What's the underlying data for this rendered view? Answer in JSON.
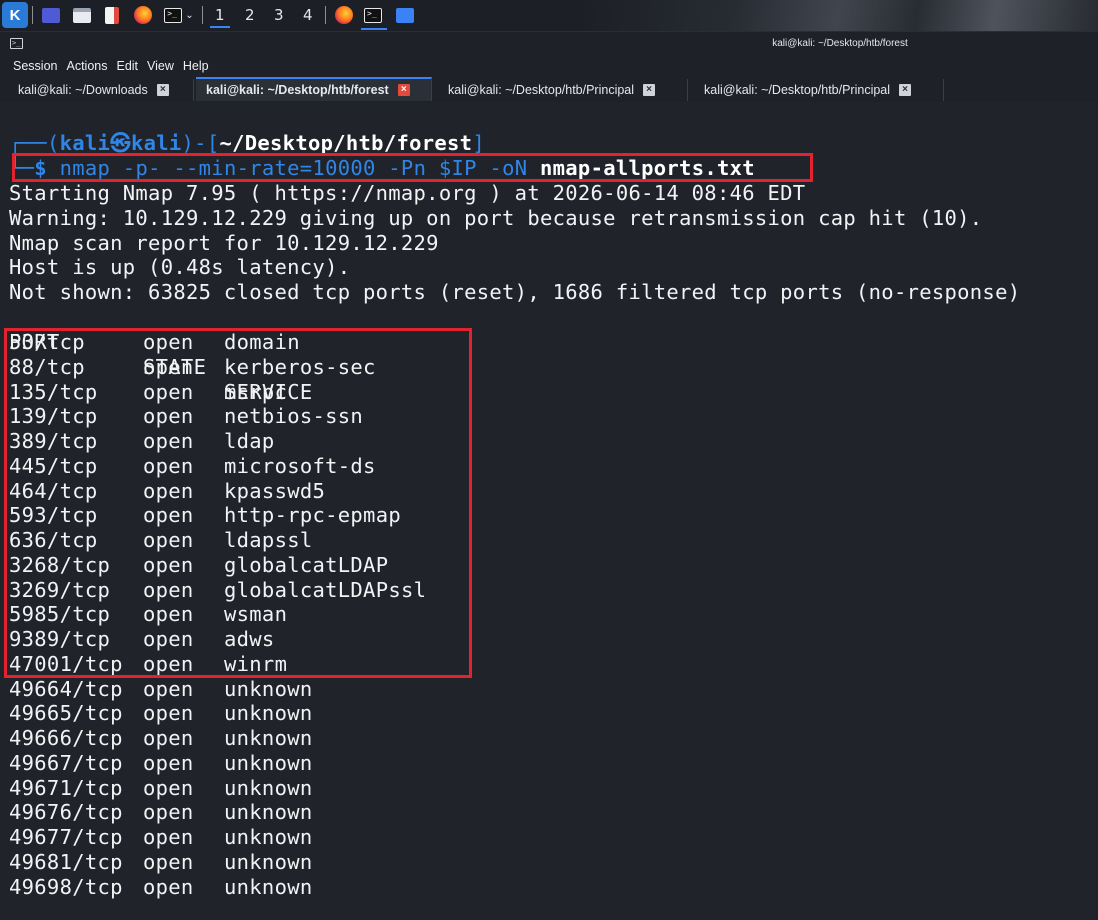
{
  "panel": {
    "workspaces": [
      "1",
      "2",
      "3",
      "4"
    ]
  },
  "window": {
    "title": "kali@kali: ~/Desktop/htb/forest"
  },
  "menu": [
    "Session",
    "Actions",
    "Edit",
    "View",
    "Help"
  ],
  "tabs": [
    {
      "label": "kali@kali: ~/Downloads",
      "active": false
    },
    {
      "label": "kali@kali: ~/Desktop/htb/forest",
      "active": true
    },
    {
      "label": "kali@kali: ~/Desktop/htb/Principal",
      "active": false
    },
    {
      "label": "kali@kali: ~/Desktop/htb/Principal",
      "active": false
    }
  ],
  "prompt": {
    "corner": "┌──",
    "open_paren": "(",
    "user_host": "kali㉿kali",
    "close_sep": ")-[",
    "path": "~/Desktop/htb/forest",
    "close_bracket": "]",
    "corner2": "└─",
    "dollar": "$",
    "command": " nmap -p- --min-rate=10000 -Pn $IP -oN ",
    "output_file": "nmap-allports.txt"
  },
  "output": {
    "lines": [
      "Starting Nmap 7.95 ( https://nmap.org ) at 2026-06-14 08:46 EDT",
      "Warning: 10.129.12.229 giving up on port because retransmission cap hit (10).",
      "Nmap scan report for 10.129.12.229",
      "Host is up (0.48s latency).",
      "Not shown: 63825 closed tcp ports (reset), 1686 filtered tcp ports (no-response)"
    ],
    "header": {
      "port": "PORT",
      "state": "STATE",
      "service": "SERVICE"
    },
    "ports": [
      {
        "port": "53/tcp",
        "state": "open",
        "service": "domain"
      },
      {
        "port": "88/tcp",
        "state": "open",
        "service": "kerberos-sec"
      },
      {
        "port": "135/tcp",
        "state": "open",
        "service": "msrpc"
      },
      {
        "port": "139/tcp",
        "state": "open",
        "service": "netbios-ssn"
      },
      {
        "port": "389/tcp",
        "state": "open",
        "service": "ldap"
      },
      {
        "port": "445/tcp",
        "state": "open",
        "service": "microsoft-ds"
      },
      {
        "port": "464/tcp",
        "state": "open",
        "service": "kpasswd5"
      },
      {
        "port": "593/tcp",
        "state": "open",
        "service": "http-rpc-epmap"
      },
      {
        "port": "636/tcp",
        "state": "open",
        "service": "ldapssl"
      },
      {
        "port": "3268/tcp",
        "state": "open",
        "service": "globalcatLDAP"
      },
      {
        "port": "3269/tcp",
        "state": "open",
        "service": "globalcatLDAPssl"
      },
      {
        "port": "5985/tcp",
        "state": "open",
        "service": "wsman"
      },
      {
        "port": "9389/tcp",
        "state": "open",
        "service": "adws"
      },
      {
        "port": "47001/tcp",
        "state": "open",
        "service": "winrm"
      },
      {
        "port": "49664/tcp",
        "state": "open",
        "service": "unknown"
      },
      {
        "port": "49665/tcp",
        "state": "open",
        "service": "unknown"
      },
      {
        "port": "49666/tcp",
        "state": "open",
        "service": "unknown"
      },
      {
        "port": "49667/tcp",
        "state": "open",
        "service": "unknown"
      },
      {
        "port": "49671/tcp",
        "state": "open",
        "service": "unknown"
      },
      {
        "port": "49676/tcp",
        "state": "open",
        "service": "unknown"
      },
      {
        "port": "49677/tcp",
        "state": "open",
        "service": "unknown"
      },
      {
        "port": "49681/tcp",
        "state": "open",
        "service": "unknown"
      },
      {
        "port": "49698/tcp",
        "state": "open",
        "service": "unknown"
      }
    ]
  },
  "colors": {
    "prompt_blue": "#2f86e6",
    "highlight_red": "#e3222f",
    "terminal_bg": "#20232a"
  }
}
